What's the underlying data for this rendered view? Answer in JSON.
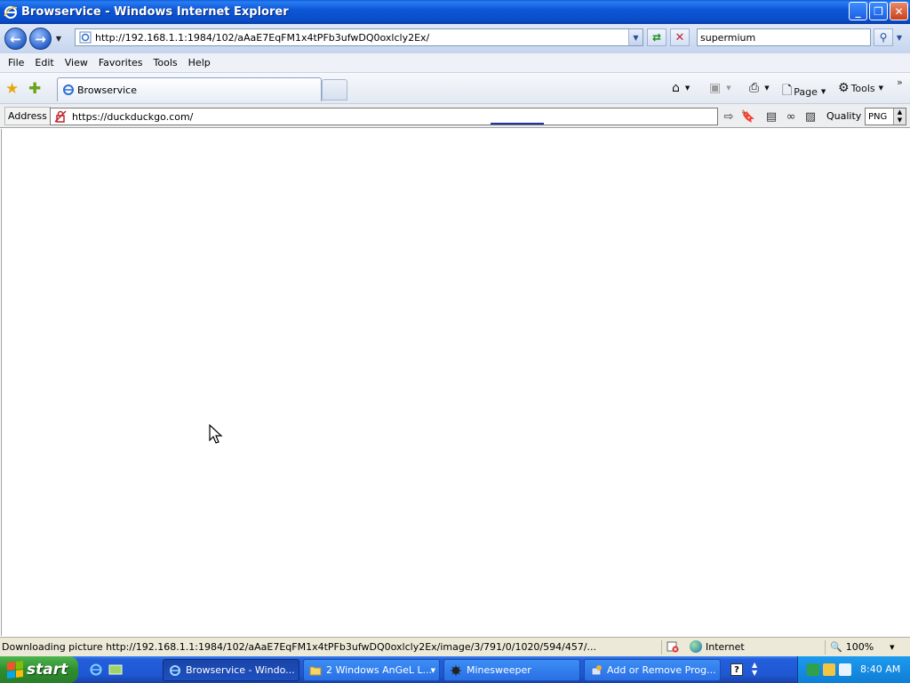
{
  "window": {
    "title": "Browservice - Windows Internet Explorer"
  },
  "nav": {
    "url": "http://192.168.1.1:1984/102/aAaE7EqFM1x4tPFb3ufwDQ0oxlcly2Ex/",
    "search_value": "supermium"
  },
  "menu": {
    "items": [
      "File",
      "Edit",
      "View",
      "Favorites",
      "Tools",
      "Help"
    ]
  },
  "tabs": {
    "active_label": "Browservice"
  },
  "commands": {
    "page_label": "Page",
    "tools_label": "Tools"
  },
  "browservice": {
    "address_label": "Address",
    "address_value": "https://duckduckgo.com/",
    "quality_label": "Quality",
    "quality_value": "PNG"
  },
  "status": {
    "text": "Downloading picture http://192.168.1.1:1984/102/aAaE7EqFM1x4tPFb3ufwDQ0oxlcly2Ex/image/3/791/0/1020/594/457/...",
    "zone": "Internet",
    "zoom": "100%"
  },
  "taskbar": {
    "start_label": "start",
    "tasks": [
      "Browservice - Windo...",
      "2 Windows AnGeL L...",
      "Minesweeper",
      "Add or Remove Prog..."
    ],
    "clock": "8:40 AM"
  },
  "colors": {
    "titlebar": "#0c57d6",
    "taskbar": "#245edb",
    "start": "#2d8f2d"
  }
}
